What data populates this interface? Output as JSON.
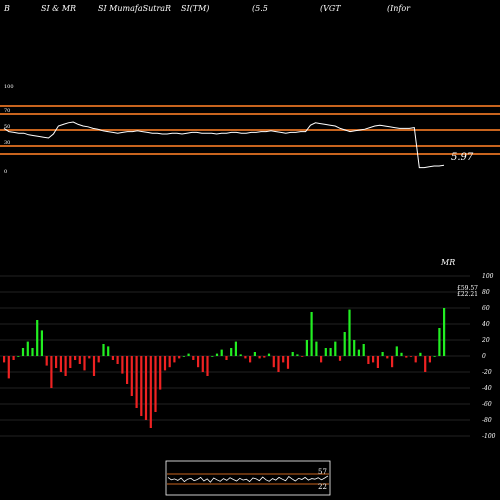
{
  "header": {
    "parts": [
      "B",
      "SI & MR",
      "SI MumafaSutraR",
      "SI(TM)",
      "(5.5",
      "(VGT",
      "(Infor"
    ]
  },
  "rsi_panel": {
    "levels": [
      100,
      70,
      50,
      30,
      0
    ],
    "extra_level_lines": [
      80,
      20
    ],
    "last_value_label": "5.97",
    "line_color": "#ffffff",
    "level_color": "#c8641e",
    "values": [
      52,
      48,
      47,
      46,
      46,
      44,
      43,
      42,
      41,
      40,
      45,
      55,
      57,
      59,
      60,
      57,
      55,
      54,
      52,
      51,
      49,
      48,
      47,
      46,
      47,
      48,
      48,
      49,
      48,
      47,
      46,
      46,
      45,
      45,
      46,
      46,
      45,
      46,
      47,
      47,
      46,
      46,
      46,
      45,
      46,
      46,
      47,
      47,
      46,
      46,
      47,
      47,
      48,
      48,
      49,
      48,
      47,
      46,
      47,
      47,
      48,
      48,
      56,
      59,
      58,
      57,
      56,
      55,
      52,
      50,
      48,
      49,
      50,
      51,
      53,
      55,
      56,
      55,
      54,
      53,
      52,
      52,
      52,
      53,
      3,
      3,
      4,
      5,
      5,
      6
    ]
  },
  "mrsi_panel": {
    "title": "MR",
    "y_ticks": [
      100,
      80,
      60,
      40,
      20,
      0,
      -20,
      -40,
      -60,
      -80,
      -100
    ],
    "overlay_labels": [
      "£59.57",
      "£22.21"
    ],
    "positive_color": "#22ee22",
    "negative_color": "#ee2222",
    "grid_color": "#444444",
    "values": [
      -8,
      -28,
      -5,
      0,
      10,
      18,
      10,
      45,
      32,
      -12,
      -40,
      -15,
      -20,
      -25,
      -15,
      -5,
      -10,
      -18,
      -3,
      -25,
      -8,
      15,
      12,
      -5,
      -10,
      -22,
      -35,
      -50,
      -65,
      -75,
      -80,
      -90,
      -70,
      -42,
      -18,
      -14,
      -8,
      -3,
      0,
      3,
      -5,
      -14,
      -20,
      -25,
      0,
      3,
      8,
      -5,
      10,
      18,
      2,
      -3,
      -8,
      5,
      -3,
      -2,
      3,
      -14,
      -20,
      -8,
      -16,
      5,
      2,
      -1,
      20,
      55,
      18,
      -8,
      10,
      10,
      18,
      -6,
      30,
      58,
      20,
      8,
      15,
      -10,
      -8,
      -15,
      5,
      -3,
      -14,
      12,
      4,
      -2,
      -1,
      -8,
      4,
      -20,
      -8,
      0,
      35,
      60
    ]
  },
  "mini_panel": {
    "labels": [
      "57",
      "22"
    ],
    "values": [
      52,
      44,
      47,
      42,
      50,
      38,
      46,
      49,
      41,
      45,
      52,
      40,
      47,
      36,
      50,
      44,
      39,
      48,
      42,
      51,
      45,
      40,
      49,
      43,
      46,
      38,
      50,
      47,
      41,
      53,
      44,
      39,
      48,
      43,
      52,
      46,
      41,
      55,
      47,
      40,
      49,
      45,
      52,
      43,
      48,
      46,
      51,
      44,
      50,
      57
    ]
  }
}
